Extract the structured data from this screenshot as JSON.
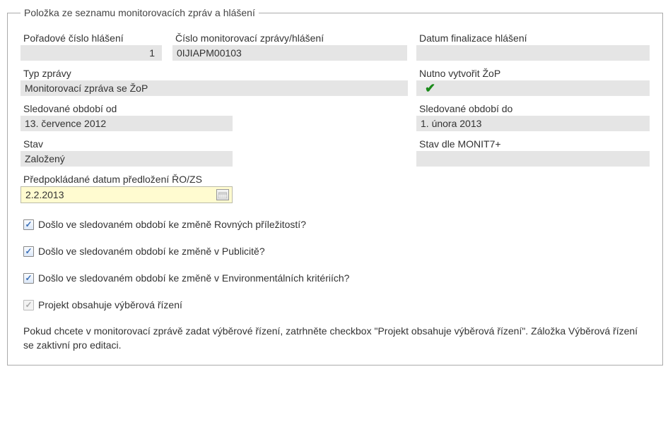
{
  "legend": "Položka ze seznamu monitorovacích zpráv a hlášení",
  "row1": {
    "poradi": {
      "label": "Pořadové číslo hlášení",
      "value": "1"
    },
    "cislo": {
      "label": "Číslo monitorovací zprávy/hlášení",
      "value": "0IJIAPM00103"
    },
    "finaliz": {
      "label": "Datum finalizace hlášení",
      "value": ""
    }
  },
  "row2": {
    "typ": {
      "label": "Typ zprávy",
      "value": "Monitorovací zpráva se ŽoP"
    },
    "nutno": {
      "label": "Nutno vytvořit ŽoP",
      "checked": true
    }
  },
  "row3": {
    "od": {
      "label": "Sledované období od",
      "value": "13. července 2012"
    },
    "do": {
      "label": "Sledované období do",
      "value": "1. února 2013"
    }
  },
  "row4": {
    "stav": {
      "label": "Stav",
      "value": "Založený"
    },
    "monit": {
      "label": "Stav dle MONIT7+",
      "value": ""
    }
  },
  "predpoklad": {
    "label": "Předpokládané datum předložení ŘO/ZS",
    "value": "2.2.2013"
  },
  "checkboxes": [
    {
      "label": "Došlo ve sledovaném období ke změně Rovných příležitostí?",
      "checked": true,
      "disabled": false
    },
    {
      "label": "Došlo ve sledovaném období ke změně v Publicitě?",
      "checked": true,
      "disabled": false
    },
    {
      "label": "Došlo ve sledovaném období ke změně v Environmentálních kritériích?",
      "checked": true,
      "disabled": false
    },
    {
      "label": "Projekt obsahuje výběrová řízení",
      "checked": true,
      "disabled": true
    }
  ],
  "footnote": "Pokud chcete v monitorovací zprávě zadat výběrové řízení, zatrhněte checkbox \"Projekt obsahuje výběrová řízení\". Záložka Výběrová řízení se zaktivní pro editaci."
}
